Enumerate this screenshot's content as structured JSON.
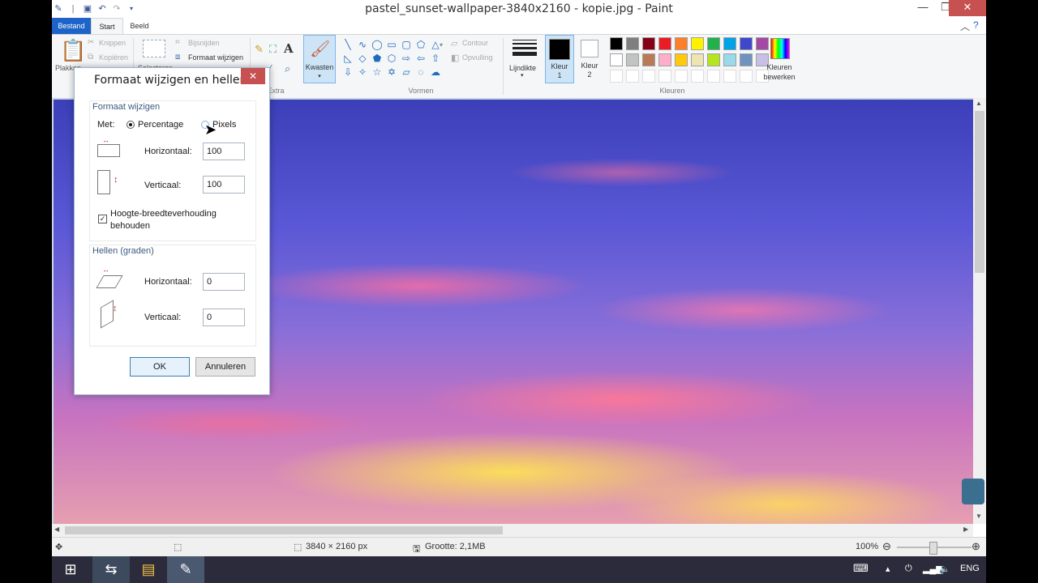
{
  "window": {
    "title": "pastel_sunset-wallpaper-3840x2160 - kopie.jpg - Paint",
    "controls": {
      "minimize": "—",
      "maximize": "❐",
      "close": "✕"
    }
  },
  "tabs": {
    "file": "Bestand",
    "start": "Start",
    "view": "Beeld"
  },
  "ribbon": {
    "clipboard": {
      "paste": "Plakken",
      "cut": "Knippen",
      "copy": "Kopiëren"
    },
    "image": {
      "select": "Selecteren",
      "crop": "Bijsnijden",
      "resize": "Formaat wijzigen"
    },
    "tools_label": "Extra",
    "brushes": "Kwasten",
    "shapes_label": "Vormen",
    "outline": "Contour",
    "fill": "Opvulling",
    "size": "Lijndikte",
    "color1": [
      "Kleur",
      "1"
    ],
    "color2": [
      "Kleur",
      "2"
    ],
    "colors_label": "Kleuren",
    "edit_colors": [
      "Kleuren",
      "bewerken"
    ],
    "palette_row1": [
      "#000000",
      "#7f7f7f",
      "#880015",
      "#ed1c24",
      "#ff7f27",
      "#fff200",
      "#22b14c",
      "#00a2e8",
      "#3f48cc",
      "#a349a4"
    ],
    "palette_row2": [
      "#ffffff",
      "#c3c3c3",
      "#b97a57",
      "#ffaec9",
      "#ffc90e",
      "#efe4b0",
      "#b5e61d",
      "#99d9ea",
      "#7092be",
      "#c8bfe7"
    ]
  },
  "dialog": {
    "title": "Formaat wijzigen en hellen",
    "resize_section": "Formaat wijzigen",
    "by_label": "Met:",
    "percentage": "Percentage",
    "pixels": "Pixels",
    "horizontal_label": "Horizontaal:",
    "horizontal_value": "100",
    "vertical_label": "Verticaal:",
    "vertical_value": "100",
    "aspect_line1": "Hoogte-breedteverhouding",
    "aspect_line2": "behouden",
    "skew_section": "Hellen (graden)",
    "skew_horizontal_label": "Horizontaal:",
    "skew_horizontal_value": "0",
    "skew_vertical_label": "Verticaal:",
    "skew_vertical_value": "0",
    "ok": "OK",
    "cancel": "Annuleren"
  },
  "status": {
    "dimensions": "3840 × 2160 px",
    "size": "Grootte: 2,1MB",
    "zoom": "100%"
  },
  "taskbar": {
    "lang": "ENG"
  }
}
